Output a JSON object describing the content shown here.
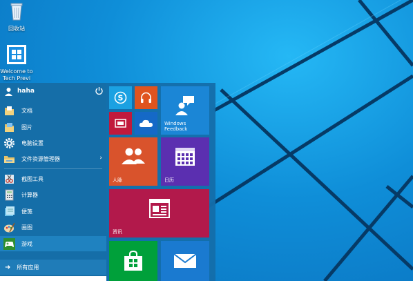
{
  "desktop": {
    "recycle_bin_label": "回收站",
    "welcome_label": "Welcome to Tech Preview",
    "welcome_label_line1": "Welcome to",
    "welcome_label_line2": "Tech Previ"
  },
  "start_menu": {
    "user_name": "haha",
    "items": [
      {
        "label": "文档",
        "icon": "folder-documents-icon"
      },
      {
        "label": "图片",
        "icon": "folder-pictures-icon"
      },
      {
        "label": "电脑设置",
        "icon": "gear-icon"
      },
      {
        "label": "文件资源管理器",
        "icon": "file-explorer-icon",
        "has_submenu": true
      },
      {
        "label": "截图工具",
        "icon": "snipping-tool-icon"
      },
      {
        "label": "计算器",
        "icon": "calculator-icon"
      },
      {
        "label": "便笺",
        "icon": "sticky-notes-icon"
      },
      {
        "label": "画图",
        "icon": "paint-icon"
      },
      {
        "label": "游戏",
        "icon": "game-controller-icon",
        "selected": true
      }
    ],
    "submenu_arrow": "›",
    "all_apps_arrow": "➜",
    "all_apps_label": "所有应用"
  },
  "tiles": {
    "skype": {
      "color": "#1ba1e2",
      "icon": "skype-icon"
    },
    "music": {
      "color": "#e0541f",
      "icon": "headphones-icon"
    },
    "video": {
      "color": "#c1193c",
      "icon": "video-icon"
    },
    "onedrive": {
      "color": "#1569c7",
      "icon": "cloud-icon"
    },
    "feedback": {
      "label_line1": "Windows",
      "label_line2": "Feedback",
      "color": "#1b86d6",
      "icon": "feedback-people-icon"
    },
    "people": {
      "label": "人脉",
      "color": "#d9532c",
      "icon": "people-icon"
    },
    "calendar": {
      "label": "日历",
      "color": "#5b2fb0",
      "icon": "calendar-icon"
    },
    "news": {
      "label": "资讯",
      "color": "#b2194b",
      "icon": "news-icon"
    },
    "store": {
      "color": "#00a03a",
      "icon": "store-bag-icon"
    },
    "mail": {
      "color": "#1a7ad0",
      "icon": "mail-icon"
    }
  }
}
